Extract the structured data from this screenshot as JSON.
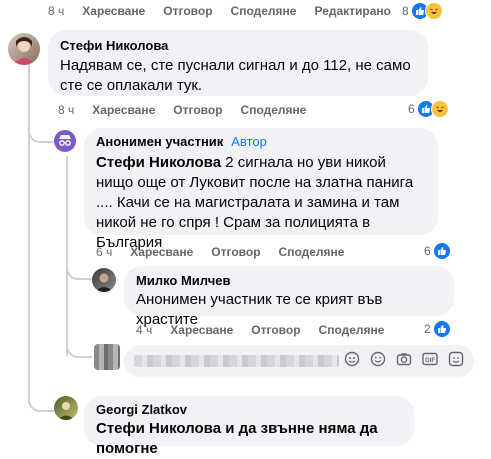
{
  "top_row": {
    "time": "8 ч",
    "like": "Харесване",
    "reply": "Отговор",
    "share": "Споделяне",
    "edited": "Редактирано",
    "count": "8"
  },
  "c1": {
    "author": "Стефи Николова",
    "text": "Надявам се, сте пуснали сигнал и до 112, не само сте се оплакали тук.",
    "time": "8 ч",
    "like": "Харесване",
    "reply": "Отговор",
    "share": "Споделяне",
    "count": "6"
  },
  "c2": {
    "author": "Анонимен участник",
    "badge": "Автор",
    "mention": "Стефи Николова",
    "text": "2 сигнала но уви никой нищо още от Луковит после на златна панига .... Качи се на магистралата и замина и там никой не го спря ! Срам за полицията в България",
    "time": "6 ч",
    "like": "Харесване",
    "reply": "Отговор",
    "share": "Споделяне",
    "count": "6"
  },
  "c3": {
    "author": "Милко Милчев",
    "text": "Анонимен участник те се крият във храстите",
    "time": "4 ч",
    "like": "Харесване",
    "reply": "Отговор",
    "share": "Споделяне",
    "count": "2"
  },
  "composer": {
    "icons": [
      "sticker-icon",
      "smiley-icon",
      "camera-icon",
      "gif-icon",
      "emoji-frame-icon"
    ]
  },
  "c4": {
    "author": "Georgi Zlatkov",
    "text_start": "Стефи Николова и да звънне няма да помогне"
  },
  "colors": {
    "like": "#1877f2",
    "bubble": "#f0f2f5",
    "meta": "#65676b",
    "thread": "#ced0d4"
  }
}
